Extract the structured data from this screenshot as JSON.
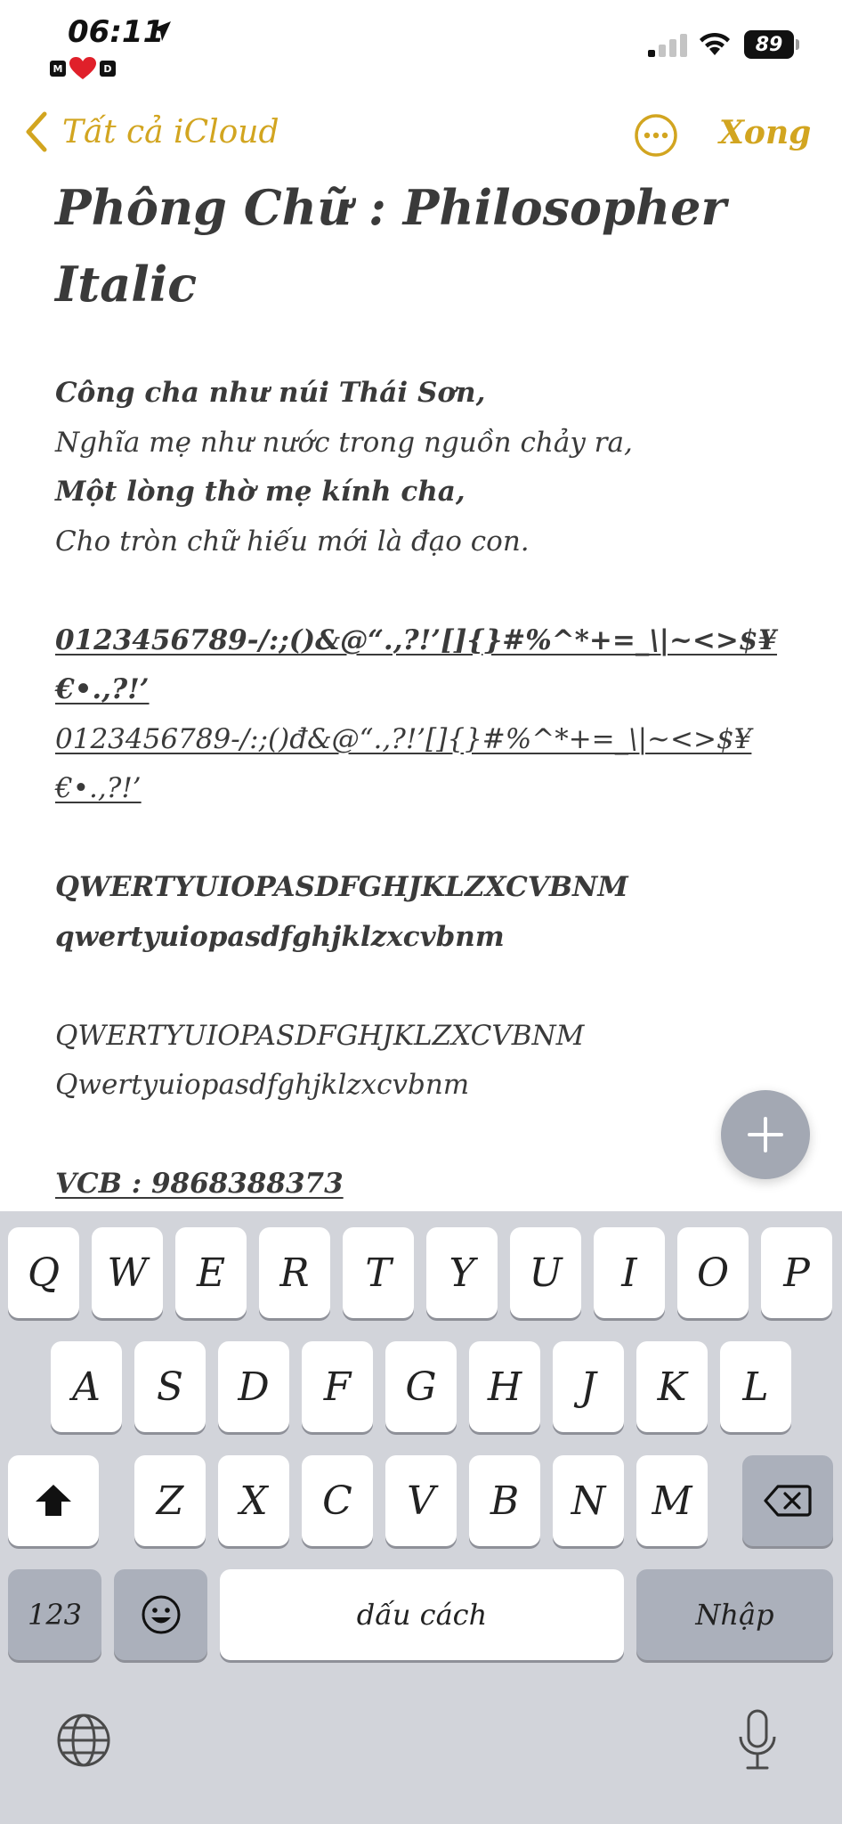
{
  "status_bar": {
    "time": "06:11",
    "focus_left": "M",
    "focus_right": "D",
    "battery": "89"
  },
  "nav": {
    "back_label": "Tất cả iCloud",
    "done_label": "Xong"
  },
  "note": {
    "title_line1": "Phông Chữ : Philosopher",
    "title_line2": "Italic",
    "poem": [
      "Công cha như núi Thái Sơn,",
      "Nghĩa mẹ như nước trong nguồn chảy ra,",
      "Một lòng thờ mẹ kính cha,",
      "Cho tròn chữ hiếu mới là đạo con."
    ],
    "symbols_bold_1": "0123456789-/:;()&@“.,?!’[]{}#%^*+=_\\|~<>$¥",
    "symbols_bold_2": "€•.,?!’",
    "symbols_regular_1": "0123456789-/:;()đ&@“.,?!’[]{}#%^*+=_\\|~<>$¥",
    "symbols_regular_2": "€•.,?!’",
    "upper_bold": "QWERTYUIOPASDFGHJKLZXCVBNM",
    "lower_bold": "qwertyuiopasdfghjklzxcvbnm",
    "upper_regular": "QWERTYUIOPASDFGHJKLZXCVBNM",
    "mixed_regular": "Qwertyuiopasdfghjklzxcvbnm",
    "bank": "VCB : 9868388373"
  },
  "keyboard": {
    "row1": [
      "Q",
      "W",
      "E",
      "R",
      "T",
      "Y",
      "U",
      "I",
      "O",
      "P"
    ],
    "row2": [
      "A",
      "S",
      "D",
      "F",
      "G",
      "H",
      "J",
      "K",
      "L"
    ],
    "row3": [
      "Z",
      "X",
      "C",
      "V",
      "B",
      "N",
      "M"
    ],
    "numbers_key": "123",
    "space_key": "dấu cách",
    "return_key": "Nhập"
  },
  "colors": {
    "accent": "#d2a520",
    "text": "#3a3a3a",
    "keyboard_bg": "#d2d4da",
    "key_dark": "#abb0bb",
    "fab": "#a3a8b3"
  }
}
